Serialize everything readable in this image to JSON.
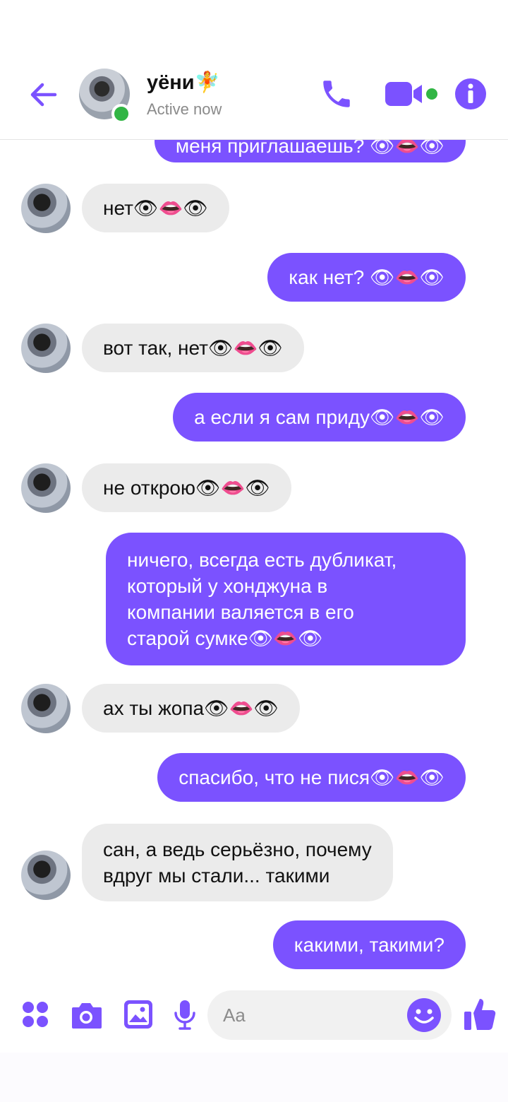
{
  "colors": {
    "accent": "#7b52ff",
    "incoming_bubble": "#ebebeb",
    "online": "#31b544"
  },
  "header": {
    "name": "уёни🧚",
    "status": "Active now",
    "icons": [
      "back-arrow-icon",
      "phone-icon",
      "video-camera-icon",
      "info-icon"
    ]
  },
  "messages": [
    {
      "side": "out",
      "text": "меня приглашаешь? 👁👄👁"
    },
    {
      "side": "in",
      "text": "нет👁👄👁"
    },
    {
      "side": "out",
      "text": "как нет? 👁👄👁"
    },
    {
      "side": "in",
      "text": "вот так, нет👁👄👁"
    },
    {
      "side": "out",
      "text": "а если я сам приду👁👄👁"
    },
    {
      "side": "in",
      "text": "не открою👁👄👁"
    },
    {
      "side": "out",
      "text": "ничего, всегда есть дубликат,\nкоторый у хонджуна в\nкомпании валяется в его\nстарой сумке👁👄👁"
    },
    {
      "side": "in",
      "text": "ах ты жопа👁👄👁"
    },
    {
      "side": "out",
      "text": "спасибо, что не пися👁👄👁"
    },
    {
      "side": "in",
      "text": "сан, а ведь серьёзно, почему\nвдруг мы стали... такими"
    },
    {
      "side": "out",
      "text": "какими, такими?"
    }
  ],
  "composer": {
    "placeholder": "Aa",
    "icons": [
      "apps-icon",
      "camera-icon",
      "gallery-icon",
      "microphone-icon",
      "emoji-icon",
      "thumbs-up-icon"
    ]
  }
}
